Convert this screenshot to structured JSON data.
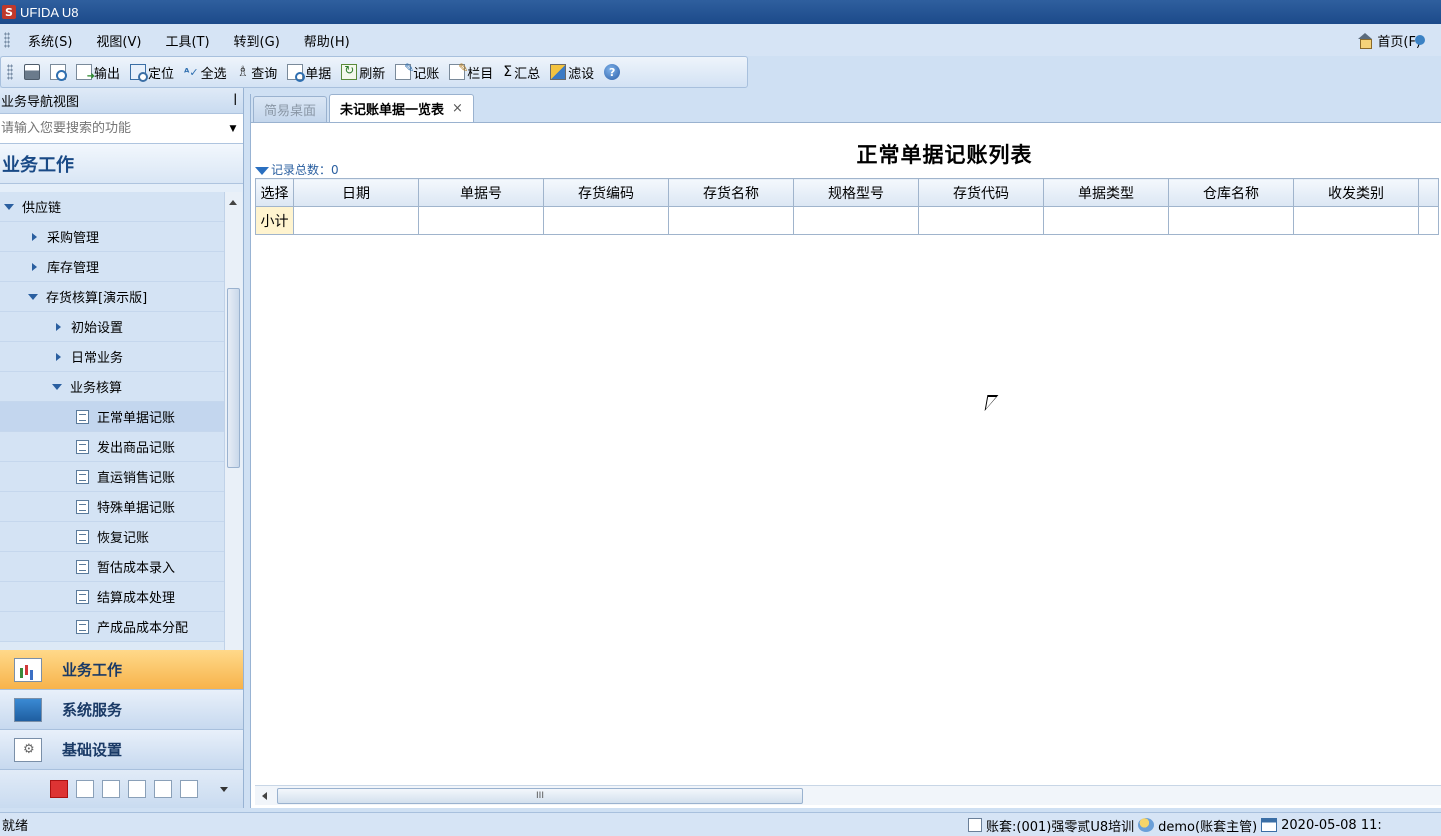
{
  "window": {
    "title": "UFIDA U8",
    "logo": "S"
  },
  "menubar": {
    "items": [
      "系统(S)",
      "视图(V)",
      "工具(T)",
      "转到(G)",
      "帮助(H)"
    ],
    "home": "首页(F)"
  },
  "toolbar": {
    "export": "输出",
    "locate": "定位",
    "select_all": "全选",
    "query": "查询",
    "document": "单据",
    "refresh": "刷新",
    "post": "记账",
    "columns": "栏目",
    "summary": "汇总",
    "filter": "滤设"
  },
  "nav": {
    "header": "业务导航视图",
    "search_placeholder": "请输入您要搜索的功能",
    "title": "业务工作",
    "tree": [
      "供应链",
      "采购管理",
      "库存管理",
      "存货核算[演示版]",
      "初始设置",
      "日常业务",
      "业务核算",
      "正常单据记账",
      "发出商品记账",
      "直运销售记账",
      "特殊单据记账",
      "恢复记账",
      "暂估成本录入",
      "结算成本处理",
      "产成品成本分配"
    ],
    "buttons": [
      "业务工作",
      "系统服务",
      "基础设置"
    ]
  },
  "tabs": {
    "desktop": "简易桌面",
    "current": "未记账单据一览表",
    "close": "×"
  },
  "report": {
    "title": "正常单据记账列表",
    "record_count": "记录总数：0",
    "columns": [
      "选择",
      "日期",
      "单据号",
      "存货编码",
      "存货名称",
      "规格型号",
      "存货代码",
      "单据类型",
      "仓库名称",
      "收发类别"
    ],
    "subtotal_label": "小计",
    "scroll_grip": "III"
  },
  "status": {
    "left": "就绪",
    "account": "账套:(001)强零贰U8培训",
    "user": "demo(账套主管)",
    "date": "2020-05-08 11:"
  }
}
